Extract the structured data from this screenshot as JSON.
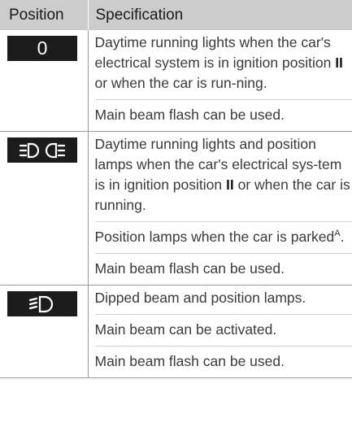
{
  "table": {
    "header_position": "Position",
    "header_specification": "Specification"
  },
  "rows": [
    {
      "symbol": "0",
      "paragraphs": [
        "Daytime running lights when the car's electrical system is in ignition position II or when the car is run-ning.",
        "Main beam flash can be used."
      ]
    },
    {
      "symbol_icon": "daytime-position-lamps-icon",
      "paragraphs": [
        "Daytime running lights and position lamps when the car's electrical sys-tem is in ignition position II or when the car is running.",
        "Position lamps when the car is parkedA.",
        "Main beam flash can be used."
      ]
    },
    {
      "symbol_icon": "dipped-beam-icon",
      "paragraphs": [
        "Dipped beam and position lamps.",
        "Main beam can be activated.",
        "Main beam flash can be used."
      ]
    }
  ],
  "text": {
    "r1p1_a": "Daytime running lights when the car's electrical system is in ignition position ",
    "r1p1_b": "II",
    "r1p1_c": " or when the car is run-ning.",
    "r2p1_a": "Daytime running lights and position lamps when the car's electrical sys-tem is in ignition position ",
    "r2p1_b": "II",
    "r2p1_c": " or when the car is running.",
    "r2p2_a": "Position lamps when the car is parked",
    "r2p2_sup": "A",
    "r2p2_c": "."
  }
}
